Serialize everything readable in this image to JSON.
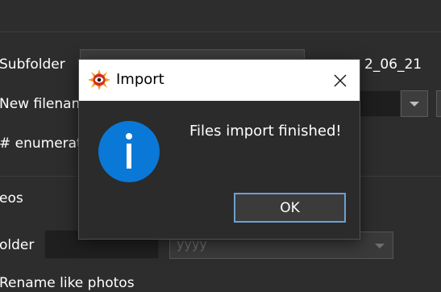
{
  "background": {
    "subfolder_label": "Subfolder",
    "subfolder_value": "2_06_21",
    "new_filename_label": "New filenam",
    "enumeration_label": "# enumerat",
    "videos_section_label": "eos",
    "folder_label": "older",
    "year_placeholder": "yyyy",
    "rename_like_photos_label": "Rename like photos"
  },
  "dialog": {
    "title": "Import",
    "message": "Files import finished!",
    "ok_label": "OK",
    "app_icon": "xnview-logo-icon",
    "info_icon": "info-icon",
    "close_icon": "close-icon",
    "colors": {
      "info_blue": "#0a78d7",
      "ok_border": "#6e9fd1",
      "titlebar": "#ffffff",
      "body": "#2b2b2b"
    }
  }
}
